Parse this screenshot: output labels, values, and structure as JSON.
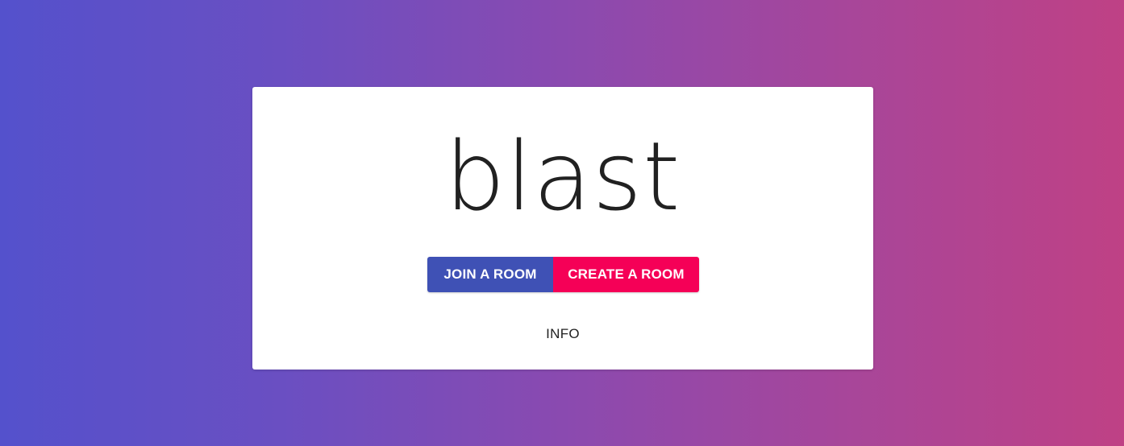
{
  "app": {
    "title": "blast"
  },
  "actions": {
    "join_label": "JOIN A ROOM",
    "create_label": "CREATE A ROOM",
    "info_label": "INFO"
  },
  "colors": {
    "join_button": "#3f51b5",
    "create_button": "#f50057",
    "background_left": "#5451cc",
    "background_right": "#bf4185"
  }
}
